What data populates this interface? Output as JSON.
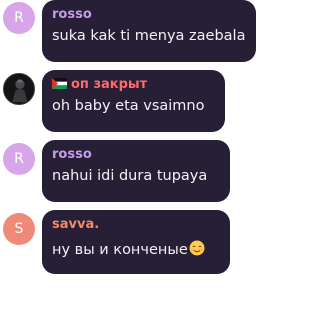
{
  "messages": [
    {
      "author": "rosso",
      "avatar_letter": "R",
      "text": "suka kak ti menya zaebala",
      "name_color": "#c59ce8"
    },
    {
      "author": "оп закрыт",
      "avatar_letter": "",
      "text": "oh baby eta vsaimno",
      "name_color": "#ff6b6b",
      "flag": "palestine-flag-icon"
    },
    {
      "author": "rosso",
      "avatar_letter": "R",
      "text": "nahui idi dura tupaya",
      "name_color": "#c59ce8"
    },
    {
      "author": "savva.",
      "avatar_letter": "S",
      "text": "ну вы и конченые",
      "name_color": "#f48a6a",
      "emoji": "smiling-blushing-face-emoji"
    }
  ],
  "colors": {
    "bubble_bg": "#261f35",
    "text": "#f4f2f7",
    "avatar_r": "#d6a6e8",
    "avatar_s": "#ef8a78"
  }
}
